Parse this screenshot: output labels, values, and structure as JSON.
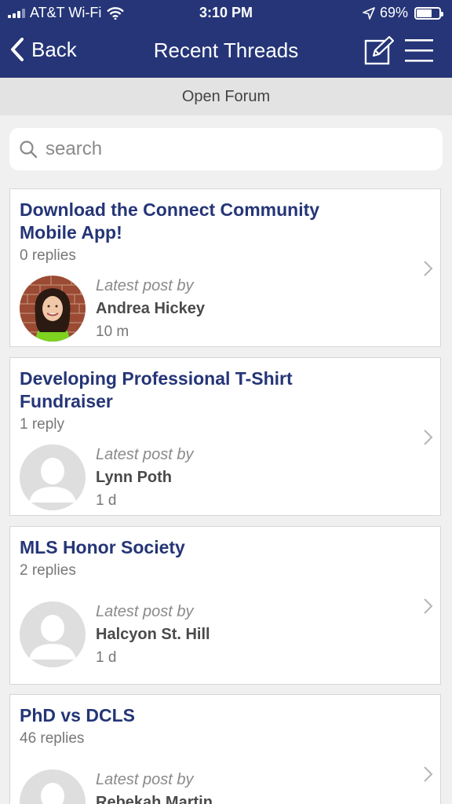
{
  "status_bar": {
    "carrier": "AT&T Wi-Fi",
    "time": "3:10 PM",
    "battery_percent": "69%",
    "battery_level": 0.69,
    "icons": [
      "signal-icon",
      "wifi-icon",
      "location-icon",
      "battery-icon"
    ]
  },
  "nav": {
    "back_label": "Back",
    "title": "Recent Threads",
    "icons": [
      "back-chevron-icon",
      "compose-icon",
      "hamburger-menu-icon"
    ]
  },
  "forum": {
    "name": "Open Forum"
  },
  "search": {
    "placeholder": "search",
    "value": "",
    "icon": "search-icon"
  },
  "threads": [
    {
      "title": "Download the Connect Community Mobile App!",
      "replies": "0 replies",
      "latest_label": "Latest post by",
      "author": "Andrea Hickey",
      "time": "10 m",
      "avatar": "photo"
    },
    {
      "title": "Developing Professional T-Shirt Fundraiser",
      "replies": "1 reply",
      "latest_label": "Latest post by",
      "author": "Lynn Poth",
      "time": "1 d",
      "avatar": "placeholder"
    },
    {
      "title": "MLS Honor Society",
      "replies": "2 replies",
      "latest_label": "Latest post by",
      "author": "Halcyon St. Hill",
      "time": "1 d",
      "avatar": "placeholder"
    },
    {
      "title": "PhD vs DCLS",
      "replies": "46 replies",
      "latest_label": "Latest post by",
      "author": "Rebekah Martin",
      "time": "",
      "avatar": "placeholder"
    }
  ],
  "colors": {
    "brand_navy": "#253577",
    "title_blue": "#253577",
    "background": "#f0f0f0"
  }
}
